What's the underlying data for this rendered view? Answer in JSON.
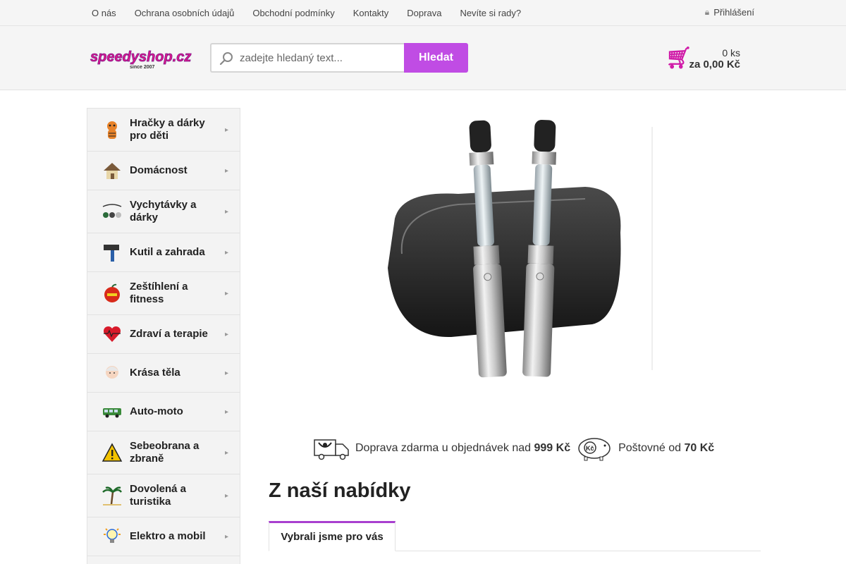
{
  "topnav": {
    "links": [
      "O nás",
      "Ochrana osobních údajů",
      "Obchodní podmínky",
      "Kontakty",
      "Doprava",
      "Nevíte si rady?"
    ],
    "login_icon": "lock-icon",
    "login_label": "Přihlášení"
  },
  "header": {
    "logo_text": "speedyshop.cz",
    "logo_tagline": "since 2007",
    "search": {
      "placeholder": "zadejte hledaný text...",
      "button_label": "Hledat",
      "icon": "search-icon"
    },
    "cart": {
      "icon": "cart-icon",
      "count": "0 ks",
      "total": "za 0,00 Kč"
    }
  },
  "sidebar": {
    "categories": [
      {
        "label": "Hračky a dárky pro děti",
        "icon": "tiger-toy-icon"
      },
      {
        "label": "Domácnost",
        "icon": "house-icon"
      },
      {
        "label": "Vychytávky a dárky",
        "icon": "gadgets-icon"
      },
      {
        "label": "Kutil a zahrada",
        "icon": "hammer-icon"
      },
      {
        "label": "Zeštíhlení a fitness",
        "icon": "apple-icon"
      },
      {
        "label": "Zdraví a terapie",
        "icon": "heart-icon"
      },
      {
        "label": "Krása těla",
        "icon": "face-icon"
      },
      {
        "label": "Auto-moto",
        "icon": "car-icon"
      },
      {
        "label": "Sebeobrana a zbraně",
        "icon": "warning-icon"
      },
      {
        "label": "Dovolená a turistika",
        "icon": "palm-icon"
      },
      {
        "label": "Elektro a mobil",
        "icon": "lightbulb-icon"
      }
    ]
  },
  "main": {
    "hero_alt": "e-cigarettes",
    "shipping": {
      "free_text": "Doprava zdarma u objednávek nad",
      "free_amount": "999 Kč",
      "postage_text": "Poštovné od",
      "postage_amount": "70 Kč"
    },
    "section_title": "Z naší nabídky",
    "tabs": [
      "Vybrali jsme pro vás"
    ]
  },
  "colors": {
    "accent": "#c04ce4",
    "cart": "#d01ba8"
  }
}
